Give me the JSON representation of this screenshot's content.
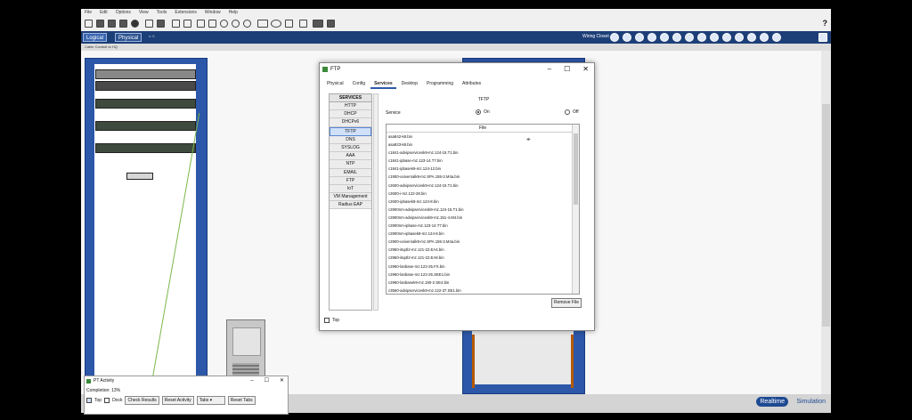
{
  "menu": [
    "File",
    "Edit",
    "Options",
    "View",
    "Tools",
    "Extensions",
    "Window",
    "Help"
  ],
  "help_glyph": "?",
  "nav": {
    "logical_label": "Logical",
    "physical_label": "Physical",
    "coords": "x: 0",
    "location": "Wiring Closet"
  },
  "breadcrumb": "Cable Conduit to HQ",
  "ftp_window": {
    "title": "FTP",
    "tabs": [
      "Physical",
      "Config",
      "Services",
      "Desktop",
      "Programming",
      "Attributes"
    ],
    "active_tab": "Services",
    "services_header": "SERVICES",
    "services": [
      "HTTP",
      "DHCP",
      "DHCPv6",
      "TFTP",
      "DNS",
      "SYSLOG",
      "AAA",
      "NTP",
      "EMAIL",
      "FTP",
      "IoT",
      "VM Management",
      "Radius EAP"
    ],
    "selected_service": "TFTP",
    "panel_title": "TFTP",
    "service_label": "Service",
    "on_label": "On",
    "off_label": "Off",
    "file_header": "File",
    "files": [
      "asa842-k8.bin",
      "asa923-k8.bin",
      "c1841-advipservicesk9-mz.124-15.T1.bin",
      "c1841-ipbase-mz.123-14.T7.bin",
      "c1841-ipbasek9-mz.124-12.bin",
      "c1900-universalk9-mz.SPA.155-3.M4a.bin",
      "c2600-advipservicesk9-mz.124-15.T1.bin",
      "c2600-i-mz.122-28.bin",
      "c2600-ipbasek9-mz.124-8.bin",
      "c2800nm-advipservicesk9-mz.124-15.T1.bin",
      "c2800nm-advipservicesk9-mz.151-4.M4.bin",
      "c2800nm-ipbase-mz.123-14.T7.bin",
      "c2800nm-ipbasek9-mz.124-8.bin",
      "c2900-universalk9-mz.SPA.155-3.M4a.bin",
      "c2950-i6q4l2-mz.121-22.EA4.bin",
      "c2950-i6q4l2-mz.121-22.EA8.bin",
      "c2960-lanbase-mz.122-25.FX.bin",
      "c2960-lanbase-mz.122-25.SEE1.bin",
      "c2960-lanbasek9-mz.150-2.SE4.bin",
      "c3560-advipservicesk9-mz.122-37.SE1.bin"
    ],
    "remove_button": "Remove File",
    "top_label": "Top"
  },
  "activity": {
    "title": "PT Activity",
    "completion": "Completion: 13%",
    "top_label": "Top",
    "dock_label": "Dock",
    "check_results": "Check Results",
    "reset_activity": "Reset Activity",
    "tabs_select": "Tabs",
    "reset_tabs": "Reset Tabs"
  },
  "mode": {
    "realtime": "Realtime",
    "simulation": "Simulation"
  },
  "colors": {
    "rack_blue": "#2d57a8",
    "nav_blue": "#1d3f78",
    "cable_green": "#7ab648"
  }
}
